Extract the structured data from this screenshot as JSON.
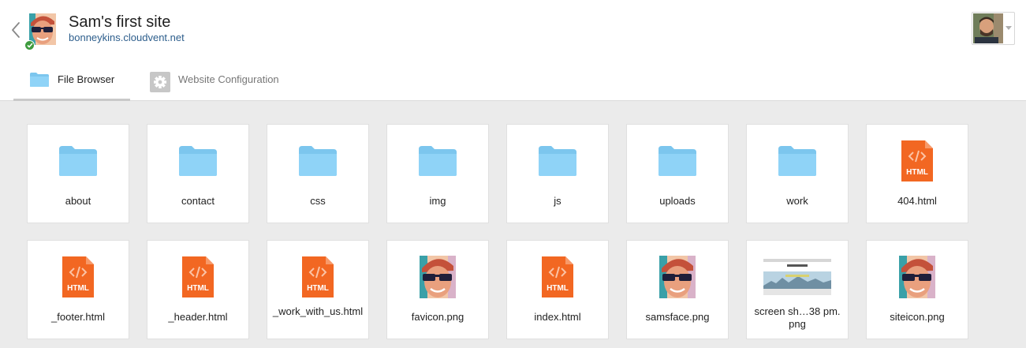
{
  "site": {
    "title": "Sam's first site",
    "url": "bonneykins.cloudvent.net",
    "status": "published"
  },
  "tabs": [
    {
      "label": "File Browser",
      "icon": "folder-icon",
      "active": true
    },
    {
      "label": "Website Configuration",
      "icon": "gear-icon",
      "active": false
    }
  ],
  "colors": {
    "folder": "#8fd3f7",
    "html_file": "#f26722",
    "link": "#2d5e8c",
    "status_ok": "#3e9b3e"
  },
  "files": [
    {
      "name": "about",
      "type": "folder"
    },
    {
      "name": "contact",
      "type": "folder"
    },
    {
      "name": "css",
      "type": "folder"
    },
    {
      "name": "img",
      "type": "folder"
    },
    {
      "name": "js",
      "type": "folder"
    },
    {
      "name": "uploads",
      "type": "folder"
    },
    {
      "name": "work",
      "type": "folder"
    },
    {
      "name": "404.html",
      "type": "html"
    },
    {
      "name": "_footer.html",
      "type": "html"
    },
    {
      "name": "_header.html",
      "type": "html"
    },
    {
      "name": "_work_with_us.html",
      "type": "html"
    },
    {
      "name": "favicon.png",
      "type": "face-image"
    },
    {
      "name": "index.html",
      "type": "html"
    },
    {
      "name": "samsface.png",
      "type": "face-image"
    },
    {
      "name": "screen sh…38 pm.png",
      "type": "screenshot-image"
    },
    {
      "name": "siteicon.png",
      "type": "face-image"
    }
  ],
  "file_icon_text": {
    "html": "HTML"
  }
}
